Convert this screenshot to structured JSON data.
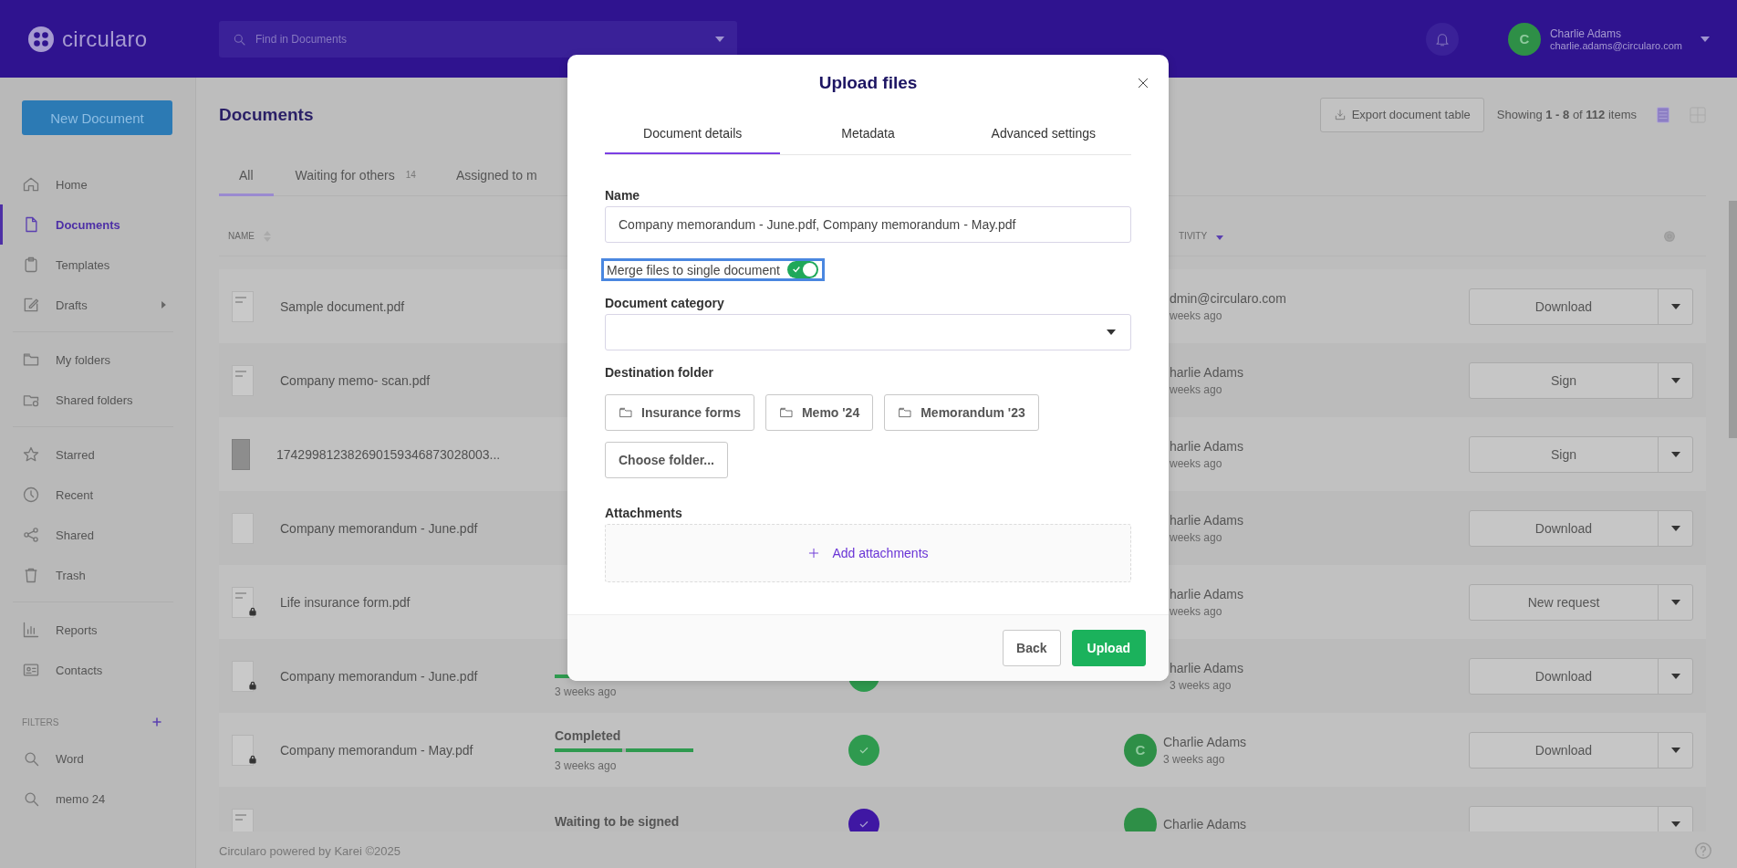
{
  "topbar": {
    "logo": "circularo",
    "search": {
      "placeholder": "Find in Documents"
    },
    "user": {
      "initial": "C",
      "name": "Charlie Adams",
      "email": "charlie.adams@circularo.com"
    }
  },
  "sidebar": {
    "new_button": "New Document",
    "groups": [
      [
        {
          "label": "Home",
          "selected": false,
          "expandable": false
        },
        {
          "label": "Documents",
          "selected": true,
          "expandable": false
        },
        {
          "label": "Templates",
          "selected": false,
          "expandable": false
        },
        {
          "label": "Drafts",
          "selected": false,
          "expandable": true
        }
      ],
      [
        {
          "label": "My folders",
          "selected": false,
          "expandable": false
        },
        {
          "label": "Shared folders",
          "selected": false,
          "expandable": false
        }
      ],
      [
        {
          "label": "Starred",
          "selected": false,
          "expandable": false
        },
        {
          "label": "Recent",
          "selected": false,
          "expandable": false
        },
        {
          "label": "Shared",
          "selected": false,
          "expandable": false
        },
        {
          "label": "Trash",
          "selected": false,
          "expandable": false
        }
      ],
      [
        {
          "label": "Reports",
          "selected": false,
          "expandable": false
        },
        {
          "label": "Contacts",
          "selected": false,
          "expandable": false
        }
      ]
    ],
    "filters_title": "FILTERS",
    "filters": [
      {
        "label": "Word"
      },
      {
        "label": "memo 24"
      }
    ]
  },
  "page": {
    "title": "Documents",
    "export_button": "Export document table",
    "showing": "Showing **1 - 8** of **112** items",
    "view_modes": [
      {
        "kind": "list",
        "selected": true
      },
      {
        "kind": "grid",
        "selected": false
      }
    ],
    "tabs": [
      {
        "label": "All",
        "selected": true
      },
      {
        "label": "Waiting for others",
        "count": "14",
        "selected": false
      },
      {
        "label": "Assigned to m",
        "selected": false
      }
    ],
    "table": {
      "columns": [
        {
          "label": "NAME",
          "sorted": false
        },
        {
          "label": "TIVITY",
          "sorted": true
        }
      ],
      "rows": [
        {
          "name": "Sample document.pdf",
          "locked": false,
          "activity": "dmin@circularo.com",
          "activity_time": "weeks ago",
          "avatar": false,
          "action": "Download"
        },
        {
          "name": "Company memo- scan.pdf",
          "locked": false,
          "activity": "harlie Adams",
          "activity_time": "weeks ago",
          "avatar": false,
          "action": "Sign"
        },
        {
          "name": "174299812382690159346873028003...",
          "locked": false,
          "activity": "harlie Adams",
          "activity_time": "weeks ago",
          "avatar": false,
          "action": "Sign"
        },
        {
          "name": "Company memorandum - June.pdf",
          "locked": false,
          "activity": "harlie Adams",
          "activity_time": "weeks ago",
          "avatar": false,
          "action": "Download"
        },
        {
          "name": "Life insurance form.pdf",
          "locked": true,
          "activity": "harlie Adams",
          "activity_time": "weeks ago",
          "avatar": false,
          "action": "New request"
        },
        {
          "name": "Company memorandum - June.pdf",
          "locked": true,
          "level": 1,
          "status_time": "3 weeks ago",
          "check": {
            "color": "#2f9a4f"
          },
          "activity": "harlie Adams",
          "activity_time": "3 weeks ago",
          "avatar": false,
          "action": "Download"
        },
        {
          "name": "Company memorandum - May.pdf",
          "locked": true,
          "status": "Completed",
          "level": 1,
          "status_time": "3 weeks ago",
          "check": {
            "color": "#2f9a4f"
          },
          "activity": "Charlie Adams",
          "activity_time": "3 weeks ago",
          "avatar": true,
          "avatar_initial": "C",
          "action": "Download"
        },
        {
          "locked": false,
          "status": "Waiting to be signed",
          "check": {
            "color": "#3f17a3"
          },
          "activity": "Charlie Adams",
          "avatar": true
        }
      ]
    }
  },
  "footer": "Circularo powered by Karei ©2025",
  "modal": {
    "title": "Upload files",
    "tabs": [
      {
        "label": "Document details",
        "selected": true
      },
      {
        "label": "Metadata",
        "selected": false
      },
      {
        "label": "Advanced settings",
        "selected": false
      }
    ],
    "name_label": "Name",
    "name_value": "Company memorandum - June.pdf, Company memorandum - May.pdf",
    "merge": {
      "label": "Merge files to single document",
      "on": true,
      "focused": true
    },
    "category_label": "Document category",
    "destination_label": "Destination folder",
    "folders": [
      "Insurance forms",
      "Memo '24",
      "Memorandum '23"
    ],
    "choose_folder": "Choose folder...",
    "attachments_label": "Attachments",
    "add_attachments": "Add attachments",
    "buttons": [
      {
        "label": "Back",
        "kind": "secondary"
      },
      {
        "label": "Upload",
        "kind": "primary"
      }
    ]
  }
}
